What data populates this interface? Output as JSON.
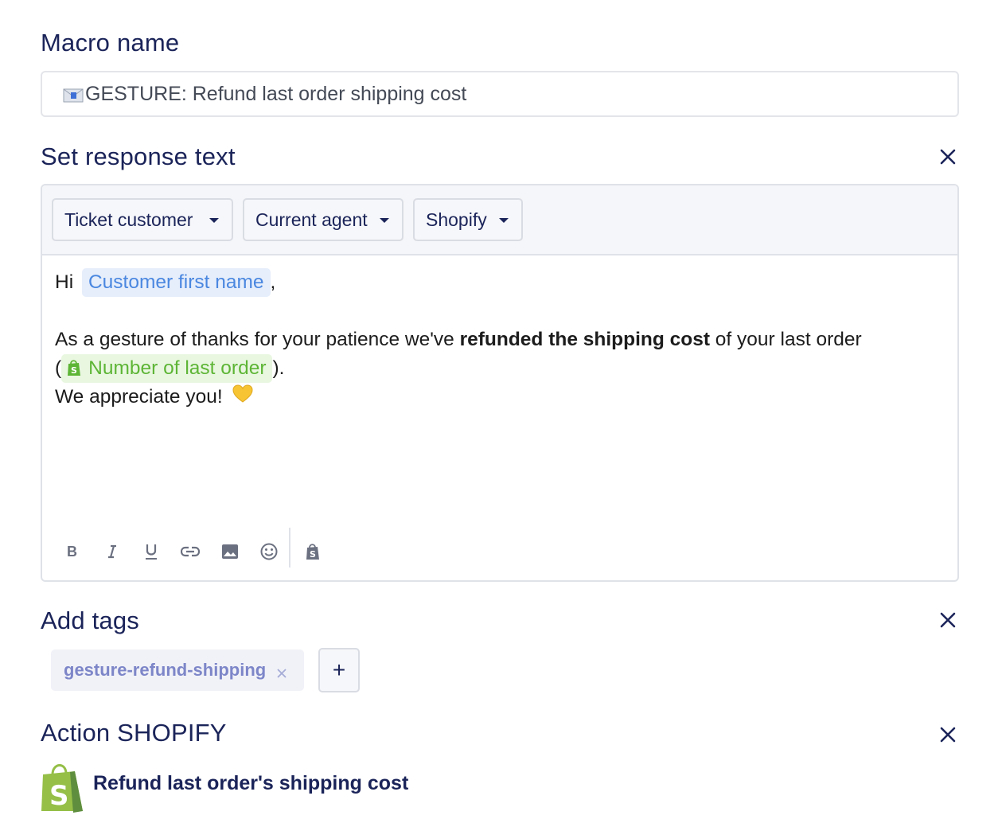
{
  "macro_name": {
    "heading": "Macro name",
    "value": "GESTURE: Refund last order shipping cost",
    "prefix_icon": "envelope-icon"
  },
  "response": {
    "heading": "Set response text",
    "variable_buttons": [
      "Ticket customer",
      "Current agent",
      "Shopify"
    ],
    "greeting": "Hi",
    "customer_var": "Customer first name",
    "comma": ",",
    "para_start": "As a gesture of thanks for your patience we've ",
    "para_bold": "refunded the shipping cost",
    "para_end": " of your last order",
    "paren_open": "(",
    "order_var": "Number of last order",
    "paren_close": ").",
    "closing": "We appreciate you!",
    "closing_emoji": "yellow-heart-icon",
    "format_tools": [
      "bold-icon",
      "italic-icon",
      "underline-icon",
      "link-icon",
      "image-icon",
      "emoji-icon",
      "shopify-icon"
    ]
  },
  "tags": {
    "heading": "Add tags",
    "items": [
      "gesture-refund-shipping"
    ],
    "add_label": "+"
  },
  "action": {
    "heading": "Action SHOPIFY",
    "label": "Refund last order's shipping cost"
  },
  "colors": {
    "heading": "#1b2459",
    "chip_blue_bg": "#e6eefb",
    "chip_blue_text": "#4a87e0",
    "chip_green_bg": "#e9f7e1",
    "chip_green_text": "#5db535",
    "tag_text": "#7d86c8",
    "shopify_green": "#95bf47"
  }
}
